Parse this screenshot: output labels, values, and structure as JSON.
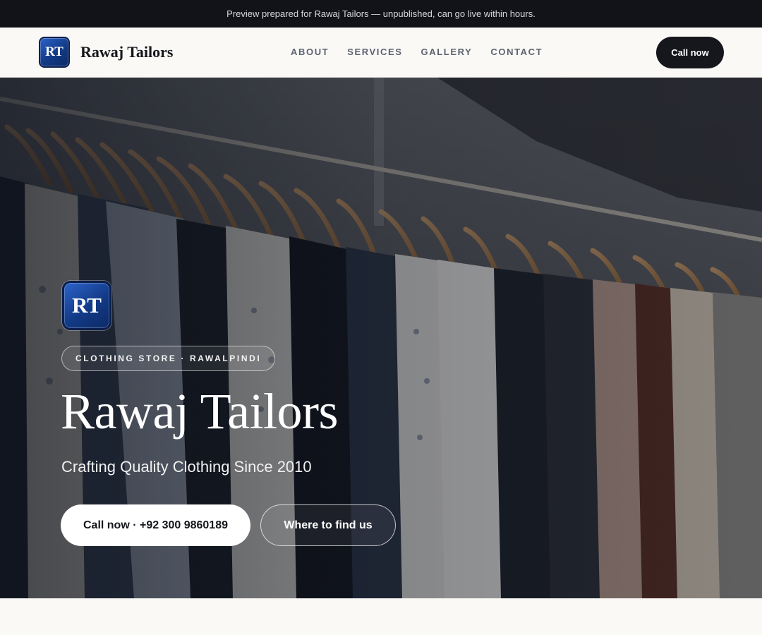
{
  "banner": {
    "text": "Preview prepared for Rawaj Tailors — unpublished, can go live within hours."
  },
  "header": {
    "logo_initials": "RT",
    "brand_name": "Rawaj Tailors",
    "nav": [
      {
        "label": "ABOUT"
      },
      {
        "label": "SERVICES"
      },
      {
        "label": "GALLERY"
      },
      {
        "label": "CONTACT"
      }
    ],
    "call_button": "Call now"
  },
  "hero": {
    "logo_initials": "RT",
    "tagline_pill": "CLOTHING STORE · RAWALPINDI",
    "title": "Rawaj Tailors",
    "subtitle": "Crafting Quality Clothing Since 2010",
    "primary_button": "Call now · +92 300 9860189",
    "secondary_button": "Where to find us",
    "background_image": "clothing-rack-photo"
  },
  "colors": {
    "banner_bg": "#111318",
    "page_bg": "#faf9f6",
    "dark_button": "#15171c",
    "logo_blue": "#123a86"
  }
}
